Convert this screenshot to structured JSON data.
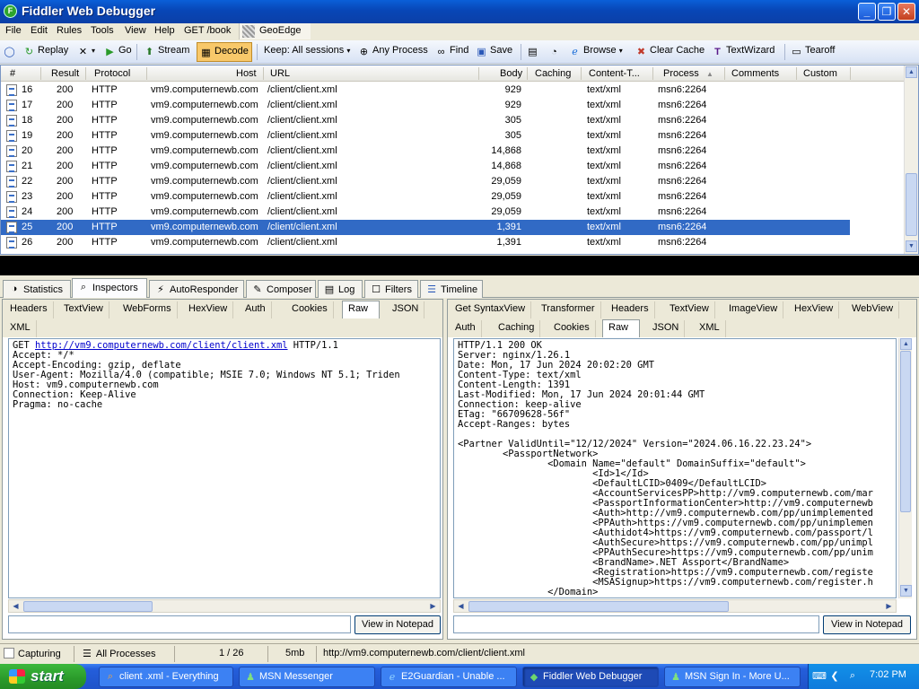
{
  "window": {
    "title": "Fiddler Web Debugger",
    "min": "_",
    "max": "❐",
    "close": "✕"
  },
  "menu": [
    "File",
    "Edit",
    "Rules",
    "Tools",
    "View",
    "Help",
    "GET /book"
  ],
  "geoedge": "GeoEdge",
  "toolbar": {
    "replay": "Replay",
    "go": "Go",
    "stream": "Stream",
    "decode": "Decode",
    "keep": "Keep: All sessions",
    "any_process": "Any Process",
    "find": "Find",
    "save": "Save",
    "browse": "Browse",
    "clear_cache": "Clear Cache",
    "textwizard": "TextWizard",
    "tearoff": "Tearoff"
  },
  "sessions": {
    "columns": [
      "#",
      "Result",
      "Protocol",
      "Host",
      "URL",
      "Body",
      "Caching",
      "Content-T...",
      "Process",
      "Comments",
      "Custom"
    ],
    "rows": [
      {
        "id": "16",
        "result": "200",
        "protocol": "HTTP",
        "host": "vm9.computernewb.com",
        "url": "/client/client.xml",
        "body": "929",
        "content_type": "text/xml",
        "process": "msn6:2264"
      },
      {
        "id": "17",
        "result": "200",
        "protocol": "HTTP",
        "host": "vm9.computernewb.com",
        "url": "/client/client.xml",
        "body": "929",
        "content_type": "text/xml",
        "process": "msn6:2264"
      },
      {
        "id": "18",
        "result": "200",
        "protocol": "HTTP",
        "host": "vm9.computernewb.com",
        "url": "/client/client.xml",
        "body": "305",
        "content_type": "text/xml",
        "process": "msn6:2264"
      },
      {
        "id": "19",
        "result": "200",
        "protocol": "HTTP",
        "host": "vm9.computernewb.com",
        "url": "/client/client.xml",
        "body": "305",
        "content_type": "text/xml",
        "process": "msn6:2264"
      },
      {
        "id": "20",
        "result": "200",
        "protocol": "HTTP",
        "host": "vm9.computernewb.com",
        "url": "/client/client.xml",
        "body": "14,868",
        "content_type": "text/xml",
        "process": "msn6:2264"
      },
      {
        "id": "21",
        "result": "200",
        "protocol": "HTTP",
        "host": "vm9.computernewb.com",
        "url": "/client/client.xml",
        "body": "14,868",
        "content_type": "text/xml",
        "process": "msn6:2264"
      },
      {
        "id": "22",
        "result": "200",
        "protocol": "HTTP",
        "host": "vm9.computernewb.com",
        "url": "/client/client.xml",
        "body": "29,059",
        "content_type": "text/xml",
        "process": "msn6:2264"
      },
      {
        "id": "23",
        "result": "200",
        "protocol": "HTTP",
        "host": "vm9.computernewb.com",
        "url": "/client/client.xml",
        "body": "29,059",
        "content_type": "text/xml",
        "process": "msn6:2264"
      },
      {
        "id": "24",
        "result": "200",
        "protocol": "HTTP",
        "host": "vm9.computernewb.com",
        "url": "/client/client.xml",
        "body": "29,059",
        "content_type": "text/xml",
        "process": "msn6:2264"
      },
      {
        "id": "25",
        "result": "200",
        "protocol": "HTTP",
        "host": "vm9.computernewb.com",
        "url": "/client/client.xml",
        "body": "1,391",
        "content_type": "text/xml",
        "process": "msn6:2264"
      },
      {
        "id": "26",
        "result": "200",
        "protocol": "HTTP",
        "host": "vm9.computernewb.com",
        "url": "/client/client.xml",
        "body": "1,391",
        "content_type": "text/xml",
        "process": "msn6:2264"
      }
    ],
    "selected_id": "25"
  },
  "main_tabs": [
    "Statistics",
    "Inspectors",
    "AutoResponder",
    "Composer",
    "Log",
    "Filters",
    "Timeline"
  ],
  "request": {
    "tabs_row1": [
      "Headers",
      "TextView",
      "WebForms",
      "HexView",
      "Auth",
      "Cookies",
      "Raw",
      "JSON"
    ],
    "tabs_row2": [
      "XML"
    ],
    "active_tab": "Raw",
    "method": "GET ",
    "url": "http://vm9.computernewb.com/client/client.xml",
    "version": " HTTP/1.1",
    "headers": "Accept: */*\nAccept-Encoding: gzip, deflate\nUser-Agent: Mozilla/4.0 (compatible; MSIE 7.0; Windows NT 5.1; Triden\nHost: vm9.computernewb.com\nConnection: Keep-Alive\nPragma: no-cache",
    "notepad_button": "View in Notepad"
  },
  "response": {
    "tabs_row1": [
      "Get SyntaxView",
      "Transformer",
      "Headers",
      "TextView",
      "ImageView",
      "HexView",
      "WebView"
    ],
    "tabs_row2": [
      "Auth",
      "Caching",
      "Cookies",
      "Raw",
      "JSON",
      "XML"
    ],
    "active_tab": "Raw",
    "body": "HTTP/1.1 200 OK\nServer: nginx/1.26.1\nDate: Mon, 17 Jun 2024 20:02:20 GMT\nContent-Type: text/xml\nContent-Length: 1391\nLast-Modified: Mon, 17 Jun 2024 20:01:44 GMT\nConnection: keep-alive\nETag: \"66709628-56f\"\nAccept-Ranges: bytes\n\n<Partner ValidUntil=\"12/12/2024\" Version=\"2024.06.16.22.23.24\">\n        <PassportNetwork>\n                <Domain Name=\"default\" DomainSuffix=\"default\">\n                        <Id>1</Id>\n                        <DefaultLCID>0409</DefaultLCID>\n                        <AccountServicesPP>http://vm9.computernewb.com/mar\n                        <PassportInformationCenter>http://vm9.computernewb\n                        <Auth>http://vm9.computernewb.com/pp/unimplemented\n                        <PPAuth>https://vm9.computernewb.com/pp/unimplemen\n                        <Authidot4>https://vm9.computernewb.com/passport/l\n                        <AuthSecure>https://vm9.computernewb.com/pp/unimpl\n                        <PPAuthSecure>https://vm9.computernewb.com/pp/unim\n                        <BrandName>.NET Assport</BrandName>\n                        <Registration>https://vm9.computernewb.com/registe\n                        <MSASignup>https://vm9.computernewb.com/register.h\n                </Domain>",
    "notepad_button": "View in Notepad"
  },
  "status": {
    "capturing": "Capturing",
    "processes": "All Processes",
    "count": "1 / 26",
    "size": "5mb",
    "url": "http://vm9.computernewb.com/client/client.xml"
  },
  "taskbar": {
    "start": "start",
    "tasks": [
      "client .xml - Everything",
      "MSN Messenger",
      "E2Guardian - Unable ...",
      "Fiddler Web Debugger",
      "MSN Sign In - More U..."
    ],
    "active_task": "Fiddler Web Debugger",
    "clock": "7:02 PM"
  }
}
